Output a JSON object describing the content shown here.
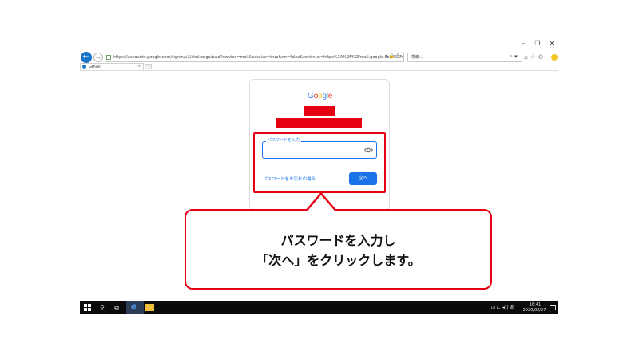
{
  "browser": {
    "window_controls": {
      "minimize": "–",
      "restore": "❐",
      "close": "✕"
    },
    "back_icon": "←",
    "forward_icon": "→",
    "address": "https://accounts.google.com/signin/v2/challenge/pwd?service=mail&passive=true&rm=false&continue=https%3A%2F%2Fmail.google.com%2Fmail%2F%3Ftab%3Dm",
    "address_icons": "▾ 🔒 C",
    "search_placeholder": "検索...",
    "search_icon": "search-icon",
    "toolbar_icons": "⌂ ☆ ⚙",
    "tab": {
      "label": "Gmail",
      "close": "×"
    }
  },
  "signin": {
    "logo_letters": [
      "G",
      "o",
      "o",
      "g",
      "l",
      "e"
    ],
    "logo_colors": [
      "#4285F4",
      "#EA4335",
      "#FBBC05",
      "#4285F4",
      "#34A853",
      "#EA4335"
    ],
    "password_label": "パスワードを入力",
    "forgot_link": "パスワードをお忘れの場合",
    "next_button": "次へ",
    "accent_color": "#1a73e8"
  },
  "callout": {
    "line1": "パスワードを入力し",
    "line2": "「次へ」をクリックします。",
    "border_color": "#e60012"
  },
  "taskbar": {
    "search_icon": "⚲",
    "taskview_icon": "⧉",
    "ie_icon": "e",
    "tray_icons": "⊡ ⊏ ◂))",
    "tray_lang": "あ",
    "clock_time": "16:41",
    "clock_date": "2020/02/27"
  }
}
